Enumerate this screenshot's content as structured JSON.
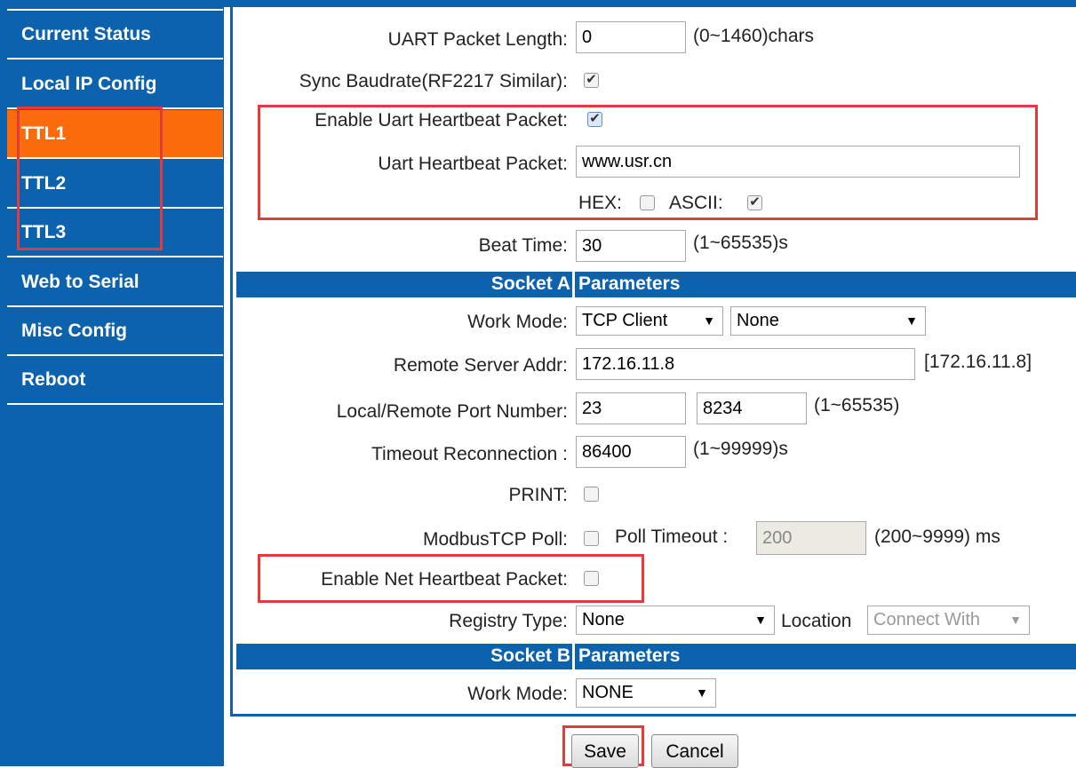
{
  "sidebar": {
    "items": [
      {
        "label": "Current Status"
      },
      {
        "label": "Local IP Config"
      },
      {
        "label": "TTL1"
      },
      {
        "label": "TTL2"
      },
      {
        "label": "TTL3"
      },
      {
        "label": "Web to Serial"
      },
      {
        "label": "Misc Config"
      },
      {
        "label": "Reboot"
      }
    ],
    "active_index": 2
  },
  "form": {
    "uart_packet_length": {
      "label": "UART Packet Length:",
      "value": "0",
      "hint": "(0~1460)chars"
    },
    "sync_baudrate": {
      "label": "Sync Baudrate(RF2217 Similar):",
      "checked": true
    },
    "enable_uart_heartbeat": {
      "label": "Enable Uart Heartbeat Packet:",
      "checked": true
    },
    "uart_heartbeat_packet": {
      "label": "Uart Heartbeat Packet:",
      "value": "www.usr.cn"
    },
    "hex": {
      "label": "HEX:",
      "checked": false
    },
    "ascii": {
      "label": "ASCII:",
      "checked": true
    },
    "beat_time": {
      "label": "Beat Time:",
      "value": "30",
      "hint": "(1~65535)s"
    }
  },
  "socket_a": {
    "header_left": "Socket A",
    "header_right": "Parameters",
    "work_mode": {
      "label": "Work Mode:",
      "value": "TCP Client",
      "sub_value": "None"
    },
    "remote_server_addr": {
      "label": "Remote Server Addr:",
      "value": "172.16.11.8",
      "hint": "[172.16.11.8]"
    },
    "port": {
      "label": "Local/Remote Port Number:",
      "local": "23",
      "remote": "8234",
      "hint": "(1~65535)"
    },
    "timeout_reconnection": {
      "label": "Timeout Reconnection :",
      "value": "86400",
      "hint": "(1~99999)s"
    },
    "print": {
      "label": "PRINT:",
      "checked": false
    },
    "modbus_tcp_poll": {
      "label": "ModbusTCP Poll:",
      "checked": false
    },
    "poll_timeout": {
      "label": "Poll Timeout :",
      "value": "200",
      "hint": "(200~9999) ms"
    },
    "enable_net_heartbeat": {
      "label": "Enable Net Heartbeat Packet:",
      "checked": false
    },
    "registry_type": {
      "label": "Registry Type:",
      "value": "None",
      "location_label": "Location",
      "location_value": "Connect With"
    }
  },
  "socket_b": {
    "header_left": "Socket B",
    "header_right": "Parameters",
    "work_mode": {
      "label": "Work Mode:",
      "value": "NONE"
    }
  },
  "buttons": {
    "save": "Save",
    "cancel": "Cancel"
  },
  "colors": {
    "sidebar": "#0d62ae",
    "active": "#f96b0b",
    "highlight": "#e23b3b"
  }
}
